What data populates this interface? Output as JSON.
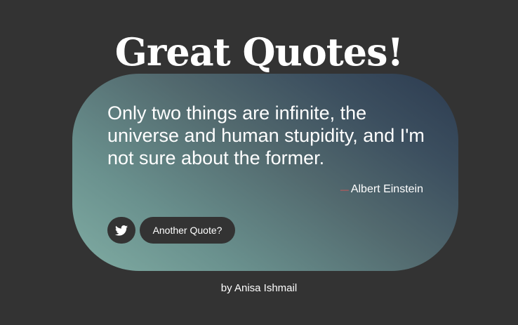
{
  "header": {
    "title": "Great Quotes!"
  },
  "quote": {
    "text": "Only two things are infinite, the universe and human stupidity, and I'm not sure about the former.",
    "author_dash": "—",
    "author": "Albert Einstein"
  },
  "actions": {
    "tweet_icon": "twitter-icon",
    "another_quote_label": "Another Quote?"
  },
  "footer": {
    "credit": "by Anisa Ishmail"
  },
  "colors": {
    "background": "#333333",
    "card_gradient_start": "#80aca3",
    "card_gradient_end": "#2c3b50",
    "button_bg": "#333333",
    "dash_accent": "#e05555",
    "text": "#ffffff"
  }
}
